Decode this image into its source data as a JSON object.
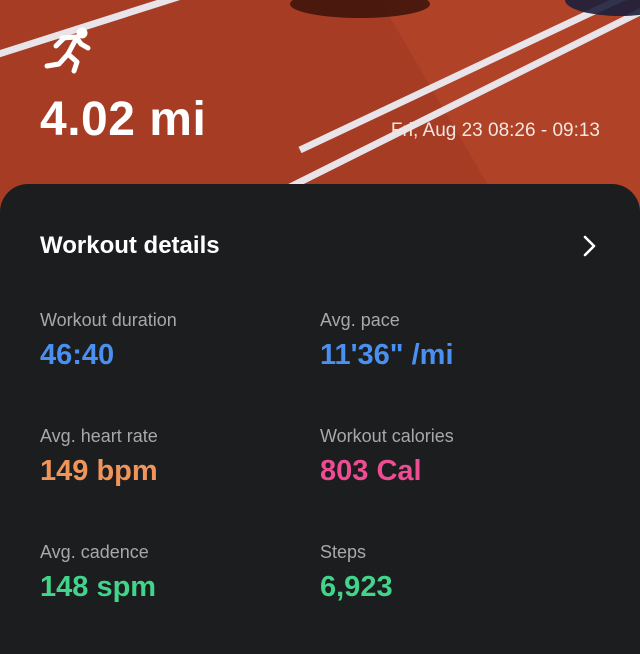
{
  "header": {
    "distance": "4.02 mi",
    "time_range": "Fri, Aug 23 08:26 - 09:13",
    "activity_icon": "running-person-icon"
  },
  "details": {
    "title": "Workout details",
    "chevron_icon": "chevron-right-icon",
    "metrics": [
      {
        "label": "Workout duration",
        "value": "46:40",
        "color": "#4a90f0"
      },
      {
        "label": "Avg. pace",
        "value": "11'36\" /mi",
        "color": "#4a90f0"
      },
      {
        "label": "Avg. heart rate",
        "value": "149 bpm",
        "color": "#f0955a"
      },
      {
        "label": "Workout calories",
        "value": "803 Cal",
        "color": "#ee4c93"
      },
      {
        "label": "Avg. cadence",
        "value": "148 spm",
        "color": "#42d48a"
      },
      {
        "label": "Steps",
        "value": "6,923",
        "color": "#42d48a"
      }
    ]
  },
  "colors": {
    "track": "#b5442a",
    "card_background": "#1c1d1f"
  }
}
